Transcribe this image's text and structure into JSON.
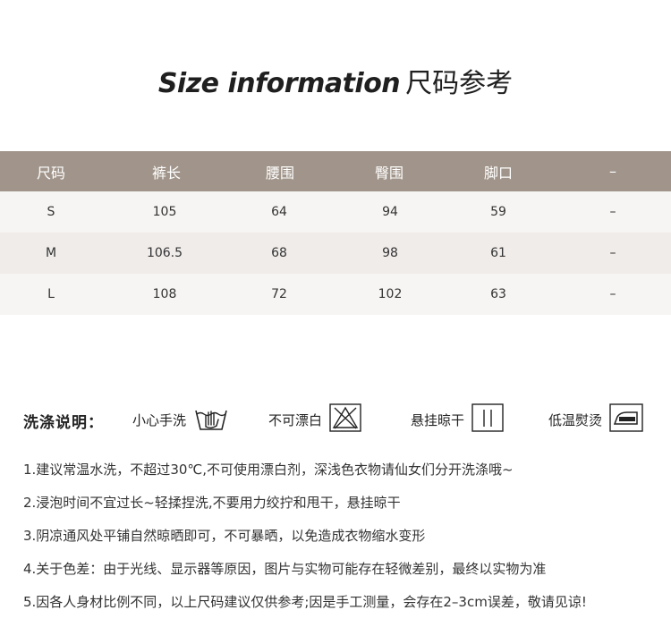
{
  "title": {
    "en": "Size information",
    "cn": "尺码参考"
  },
  "size_table": {
    "headers": [
      "尺码",
      "裤长",
      "腰围",
      "臀围",
      "脚口",
      "–"
    ],
    "rows": [
      [
        "S",
        "105",
        "64",
        "94",
        "59",
        "–"
      ],
      [
        "M",
        "106.5",
        "68",
        "98",
        "61",
        "–"
      ],
      [
        "L",
        "108",
        "72",
        "102",
        "63",
        "–"
      ]
    ]
  },
  "washing": {
    "title": "洗涤说明：",
    "items": [
      {
        "label": "小心手洗",
        "icon": "hand-wash-icon"
      },
      {
        "label": "不可漂白",
        "icon": "no-bleach-icon"
      },
      {
        "label": "悬挂晾干",
        "icon": "line-dry-icon"
      },
      {
        "label": "低温熨烫",
        "icon": "low-iron-icon"
      }
    ]
  },
  "notes": [
    "1.建议常温水洗，不超过30℃,不可使用漂白剂，深浅色衣物请仙女们分开洗涤哦~",
    "2.浸泡时间不宜过长~轻揉捏洗,不要用力绞拧和甩干，悬挂晾干",
    "3.阴凉通风处平铺自然晾晒即可，不可暴晒，以免造成衣物缩水变形",
    "4.关于色差：由于光线、显示器等原因，图片与实物可能存在轻微差别，最终以实物为准",
    "5.因各人身材比例不同，以上尺码建议仅供参考;因是手工测量，会存在2–3cm误差，敬请见谅!"
  ],
  "colors": {
    "header_bg": "#a1958b",
    "row_light": "#f7f5f3",
    "row_dark": "#efecea"
  }
}
